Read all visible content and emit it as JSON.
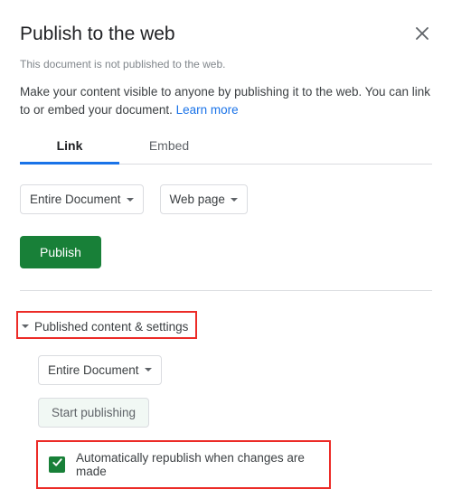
{
  "dialog": {
    "title": "Publish to the web",
    "status": "This document is not published to the web.",
    "description": "Make your content visible to anyone by publishing it to the web. You can link to or embed your document. ",
    "learn_more": "Learn more"
  },
  "tabs": {
    "link": "Link",
    "embed": "Embed"
  },
  "selects": {
    "scope": "Entire Document",
    "format": "Web page"
  },
  "buttons": {
    "publish": "Publish",
    "start_publishing": "Start publishing"
  },
  "expander": {
    "label": "Published content & settings",
    "scope": "Entire Document"
  },
  "checkbox": {
    "auto_republish": "Automatically republish when changes are made"
  }
}
